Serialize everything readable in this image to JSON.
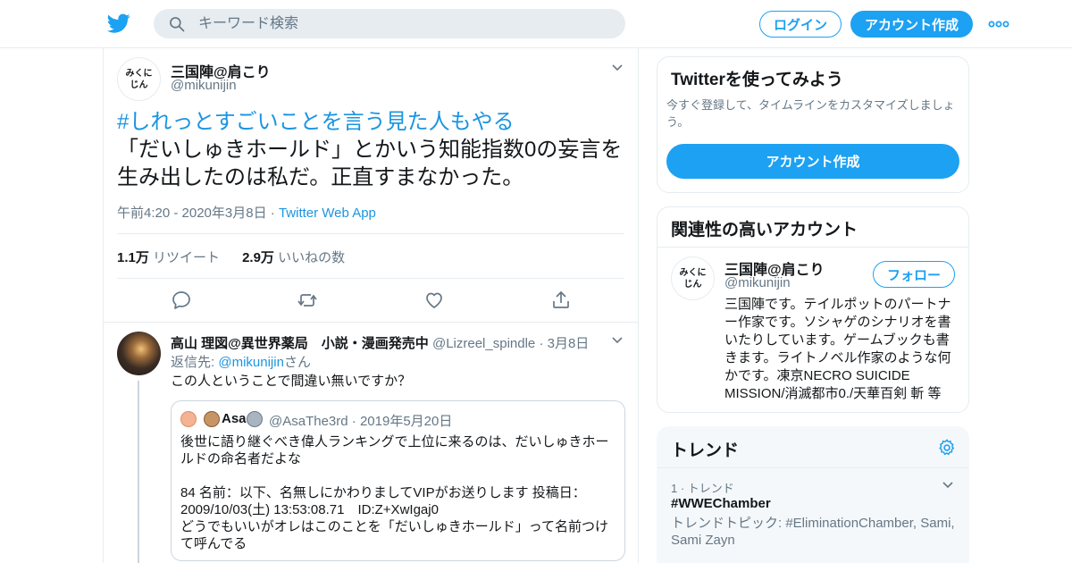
{
  "header": {
    "logo_icon": "twitter-bird-icon",
    "search_placeholder": "キーワード検索",
    "login_label": "ログイン",
    "signup_label": "アカウント作成",
    "more_icon": "more-dots-icon",
    "brand_color": "#1da1f2"
  },
  "tweet": {
    "avatar_line1": "みくに",
    "avatar_line2": "じん",
    "author_name": "三国陣@肩こり",
    "author_handle": "@mikunijin",
    "hashtag": "#しれっとすごいことを言う見た人もやる",
    "body": "「だいしゅきホールド」とかいう知能指数0の妄言を生み出したのは私だ。正直すまなかった。",
    "time": "午前4:20 - 2020年3月8日",
    "source_sep": " · ",
    "source": "Twitter Web App",
    "retweets_count": "1.1万",
    "retweets_label": "リツイート",
    "likes_count": "2.9万",
    "likes_label": "いいねの数",
    "actions": [
      "reply-icon",
      "retweet-icon",
      "like-icon",
      "share-icon"
    ]
  },
  "reply": {
    "author_name": "高山 理図@異世界薬局　小説・漫画発売中",
    "author_handle": "@Lizreel_spindle",
    "date": "· 3月8日",
    "reply_to_label": "返信先: ",
    "reply_to_handle": "@mikunijin",
    "reply_to_suffix": "さん",
    "text": "この人ということで間違い無いですか？",
    "quote": {
      "author_name": "Asa",
      "author_handle": "@AsaThe3rd",
      "date": "· 2019年5月20日",
      "line1": "後世に語り継ぐべき偉人ランキングで上位に来るのは、だいしゅきホールドの命名者だよな",
      "line2": "84 名前：以下、名無しにかわりましてVIPがお送りします 投稿日：2009/10/03(土) 13:53:08.71　ID:Z+XwIgaj0",
      "line3": "どうでもいいがオレはこのことを「だいしゅきホールド」って名前つけて呼んでる"
    }
  },
  "sidebar": {
    "signup_card": {
      "title": "Twitterを使ってみよう",
      "description": "今すぐ登録して、タイムラインをカスタマイズしましょう。",
      "button": "アカウント作成"
    },
    "related": {
      "title": "関連性の高いアカウント",
      "avatar_line1": "みくに",
      "avatar_line2": "じん",
      "name": "三国陣@肩こり",
      "handle": "@mikunijin",
      "follow_label": "フォロー",
      "bio": "三国陣です。テイルポットのパートナー作家です。ソシャゲのシナリオを書いたりしています。ゲームブックも書きます。ライトノベル作家のような何かです。凍京NECRO SUICIDE MISSION/消滅都市0./天華百剣 斬 等"
    },
    "trends": {
      "title": "トレンド",
      "items": [
        {
          "meta": "1 · トレンド",
          "name": "#WWEChamber",
          "topic": "トレンドトピック: #EliminationChamber, Sami, Sami Zayn"
        }
      ]
    }
  }
}
